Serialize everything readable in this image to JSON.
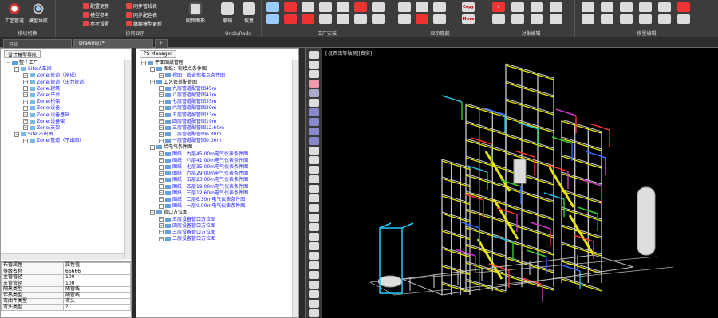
{
  "ribbon": {
    "groups": [
      {
        "label": "模块切换",
        "buttons": [
          "工艺管道",
          "模型导航"
        ]
      },
      {
        "label": "协同显示",
        "buttons": [
          "配置更新",
          "模型参考",
          "参考设置",
          "同步管线表",
          "同步配色表",
          "继续模型更新",
          "同步图形"
        ]
      },
      {
        "label": "Undo/Redo",
        "buttons": [
          "撤销",
          "恢复"
        ]
      },
      {
        "label": "工厂安装",
        "buttons": []
      },
      {
        "label": "显示隐藏",
        "buttons": [
          "Copy",
          "Move"
        ]
      },
      {
        "label": "对象编辑",
        "buttons": []
      },
      {
        "label": "模型编辑",
        "buttons": []
      }
    ]
  },
  "doc_tabs": [
    "开始",
    "Drawing1*",
    "+"
  ],
  "left_panel": {
    "title": "设计模型导航",
    "tree": [
      {
        "level": 0,
        "text": "整个工厂",
        "blue": false
      },
      {
        "level": 1,
        "text": "Site:A车间",
        "blue": true
      },
      {
        "level": 2,
        "text": "Zone:管道（常规）",
        "blue": true
      },
      {
        "level": 2,
        "text": "Zone:管道（压力管道）",
        "blue": true
      },
      {
        "level": 2,
        "text": "Zone:建筑",
        "blue": true
      },
      {
        "level": 2,
        "text": "Zone:平台",
        "blue": true
      },
      {
        "level": 2,
        "text": "Zone:桥架",
        "blue": true
      },
      {
        "level": 2,
        "text": "Zone:设备",
        "blue": true
      },
      {
        "level": 2,
        "text": "Zone:设备基础",
        "blue": true
      },
      {
        "level": 2,
        "text": "Zone:设备架",
        "blue": true
      },
      {
        "level": 2,
        "text": "Zone:支架",
        "blue": true
      },
      {
        "level": 1,
        "text": "Site:不出图",
        "blue": true
      },
      {
        "level": 2,
        "text": "Zone:管道（不出图）",
        "blue": true
      }
    ],
    "props": [
      [
        "布管属性",
        "属性值"
      ],
      [
        "等级名称",
        "66666"
      ],
      [
        "主管管径",
        "100"
      ],
      [
        "支管管径",
        "100"
      ],
      [
        "隔热类型",
        "随管线"
      ],
      [
        "伴热类型",
        "随管线"
      ],
      [
        "弯曲件类型",
        "弯头"
      ],
      [
        "弯头类型",
        "?"
      ]
    ]
  },
  "mid_panel": {
    "title": "PS Manager",
    "tree": [
      {
        "level": 0,
        "text": "平面图纸管理"
      },
      {
        "level": 1,
        "text": "图纸：衔接点条件图"
      },
      {
        "level": 2,
        "text": "视图：管道衔接点条件图"
      },
      {
        "level": 1,
        "text": "工艺管道配管图"
      },
      {
        "level": 2,
        "text": "九层管道配管图45m"
      },
      {
        "level": 2,
        "text": "八层管道配管图41m"
      },
      {
        "level": 2,
        "text": "七层管道配管图35m"
      },
      {
        "level": 2,
        "text": "六层管道配管图29m"
      },
      {
        "level": 2,
        "text": "五层管道配管图23m"
      },
      {
        "level": 2,
        "text": "四层管道配管图19m"
      },
      {
        "level": 2,
        "text": "三层管道配管图12.60m"
      },
      {
        "level": 2,
        "text": "二层管道配管图6.30m"
      },
      {
        "level": 2,
        "text": "一层管道配管图0.00m"
      },
      {
        "level": 1,
        "text": "给电气条件图"
      },
      {
        "level": 2,
        "text": "图纸：九层45.00m电气仪表条件图"
      },
      {
        "level": 2,
        "text": "图纸：八层41.00m电气仪表条件图"
      },
      {
        "level": 2,
        "text": "图纸：七层35.00m电气仪表条件图"
      },
      {
        "level": 2,
        "text": "图纸：六层29.00m电气仪表条件图"
      },
      {
        "level": 2,
        "text": "图纸：五层23.00m电气仪表条件图"
      },
      {
        "level": 2,
        "text": "图纸：四层19.00m电气仪表条件图"
      },
      {
        "level": 2,
        "text": "图纸：三层12.60m电气仪表条件图"
      },
      {
        "level": 2,
        "text": "图纸：二层6.30m电气仪表条件图"
      },
      {
        "level": 2,
        "text": "图纸：一层0.00m电气仪表条件图"
      },
      {
        "level": 1,
        "text": "管口方位图"
      },
      {
        "level": 2,
        "text": "五层设备管口方位图"
      },
      {
        "level": 2,
        "text": "四层设备管口方位图"
      },
      {
        "level": 2,
        "text": "三层设备管口方位图"
      },
      {
        "level": 2,
        "text": "二层设备管口方位图"
      }
    ]
  },
  "viewport": {
    "label": "[-][西南等轴测][真实]"
  }
}
